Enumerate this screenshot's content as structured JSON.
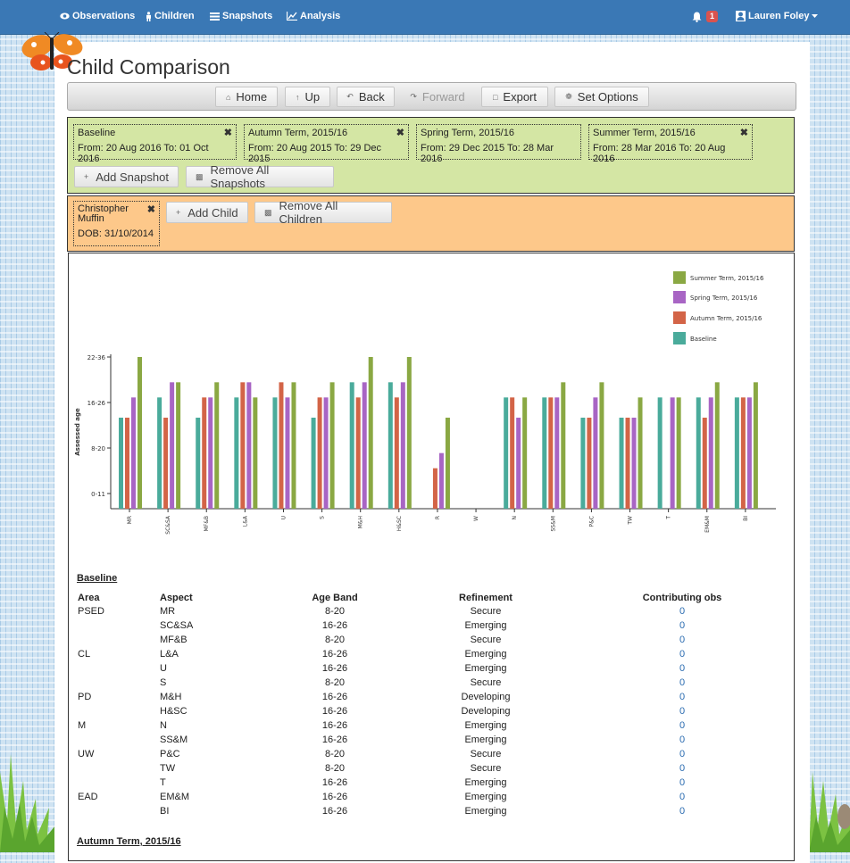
{
  "nav": {
    "observations": "Observations",
    "children": "Children",
    "snapshots": "Snapshots",
    "analysis": "Analysis",
    "notification_count": "1",
    "user_name": "Lauren Foley"
  },
  "page": {
    "title": "Child Comparison"
  },
  "toolbar": {
    "home": "Home",
    "up": "Up",
    "back": "Back",
    "forward": "Forward",
    "export": "Export",
    "set_options": "Set Options"
  },
  "snapshots": [
    {
      "name": "Baseline",
      "from": "20 Aug 2016",
      "to": "01 Oct 2016",
      "range": "From: 20 Aug 2016  To: 01 Oct 2016"
    },
    {
      "name": "Autumn Term, 2015/16",
      "from": "20 Aug 2015",
      "to": "29 Dec 2015",
      "range": "From: 20 Aug 2015  To: 29 Dec 2015"
    },
    {
      "name": "Spring Term, 2015/16",
      "from": "29 Dec 2015",
      "to": "28 Mar 2016",
      "range": "From: 29 Dec 2015  To: 28 Mar 2016"
    },
    {
      "name": "Summer Term, 2015/16",
      "from": "28 Mar 2016",
      "to": "20 Aug 2016",
      "range": "From: 28 Mar 2016  To: 20 Aug 2016"
    }
  ],
  "snapshot_actions": {
    "add": "Add Snapshot",
    "remove_all": "Remove All Snapshots"
  },
  "child": {
    "name": "Christopher Muffin",
    "dob": "DOB: 31/10/2014"
  },
  "child_actions": {
    "add": "Add Child",
    "remove_all": "Remove All Children"
  },
  "colors": {
    "baseline": "#4aab9b",
    "autumn": "#d36447",
    "spring": "#a865c4",
    "summer": "#8aa843",
    "navbar": "#3a78b5",
    "snapshot_bg": "#d4e6a4",
    "child_bg": "#fdc88a"
  },
  "chart_data": {
    "type": "bar",
    "ylabel": "Assessed age",
    "y_ticks": [
      "0-11",
      "8-20",
      "16-26",
      "22-36"
    ],
    "categories": [
      "MR",
      "SC&SA",
      "MF&B",
      "L&A",
      "U",
      "S",
      "M&H",
      "H&SC",
      "R",
      "W",
      "N",
      "SS&M",
      "P&C",
      "TW",
      "T",
      "EM&M",
      "BI"
    ],
    "legend_position": "top-right",
    "series": [
      {
        "name": "Baseline",
        "values": [
          1.8,
          2.2,
          1.8,
          2.2,
          2.2,
          1.8,
          2.5,
          2.5,
          null,
          null,
          2.2,
          2.2,
          1.8,
          1.8,
          2.2,
          2.2,
          2.2
        ]
      },
      {
        "name": "Autumn Term, 2015/16",
        "values": [
          1.8,
          1.8,
          2.2,
          2.5,
          2.5,
          2.2,
          2.2,
          2.2,
          0.8,
          null,
          2.2,
          2.2,
          1.8,
          1.8,
          null,
          1.8,
          2.2
        ]
      },
      {
        "name": "Spring Term, 2015/16",
        "values": [
          2.2,
          2.5,
          2.2,
          2.5,
          2.2,
          2.2,
          2.5,
          2.5,
          1.1,
          null,
          1.8,
          2.2,
          2.2,
          1.8,
          2.2,
          2.2,
          2.2
        ]
      },
      {
        "name": "Summer Term, 2015/16",
        "values": [
          3.0,
          2.5,
          2.5,
          2.2,
          2.5,
          2.5,
          3.0,
          3.0,
          1.8,
          null,
          2.2,
          2.5,
          2.5,
          2.2,
          2.2,
          2.5,
          2.5
        ]
      }
    ]
  },
  "table": {
    "section_title": "Baseline",
    "headers": {
      "area": "Area",
      "aspect": "Aspect",
      "band": "Age Band",
      "refinement": "Refinement",
      "obs": "Contributing obs"
    },
    "rows": [
      {
        "area": "PSED",
        "aspect": "MR",
        "band": "8-20",
        "refinement": "Secure",
        "obs": "0"
      },
      {
        "area": "",
        "aspect": "SC&SA",
        "band": "16-26",
        "refinement": "Emerging",
        "obs": "0"
      },
      {
        "area": "",
        "aspect": "MF&B",
        "band": "8-20",
        "refinement": "Secure",
        "obs": "0"
      },
      {
        "area": "CL",
        "aspect": "L&A",
        "band": "16-26",
        "refinement": "Emerging",
        "obs": "0"
      },
      {
        "area": "",
        "aspect": "U",
        "band": "16-26",
        "refinement": "Emerging",
        "obs": "0"
      },
      {
        "area": "",
        "aspect": "S",
        "band": "8-20",
        "refinement": "Secure",
        "obs": "0"
      },
      {
        "area": "PD",
        "aspect": "M&H",
        "band": "16-26",
        "refinement": "Developing",
        "obs": "0"
      },
      {
        "area": "",
        "aspect": "H&SC",
        "band": "16-26",
        "refinement": "Developing",
        "obs": "0"
      },
      {
        "area": "M",
        "aspect": "N",
        "band": "16-26",
        "refinement": "Emerging",
        "obs": "0"
      },
      {
        "area": "",
        "aspect": "SS&M",
        "band": "16-26",
        "refinement": "Emerging",
        "obs": "0"
      },
      {
        "area": "UW",
        "aspect": "P&C",
        "band": "8-20",
        "refinement": "Secure",
        "obs": "0"
      },
      {
        "area": "",
        "aspect": "TW",
        "band": "8-20",
        "refinement": "Secure",
        "obs": "0"
      },
      {
        "area": "",
        "aspect": "T",
        "band": "16-26",
        "refinement": "Emerging",
        "obs": "0"
      },
      {
        "area": "EAD",
        "aspect": "EM&M",
        "band": "16-26",
        "refinement": "Emerging",
        "obs": "0"
      },
      {
        "area": "",
        "aspect": "BI",
        "band": "16-26",
        "refinement": "Emerging",
        "obs": "0"
      }
    ],
    "next_section_title": "Autumn Term, 2015/16"
  }
}
